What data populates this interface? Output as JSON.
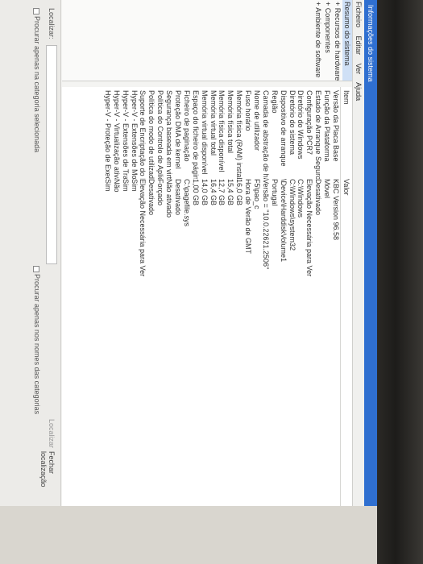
{
  "window": {
    "title": "Informações do sistema"
  },
  "menu": [
    "Ficheiro",
    "Editar",
    "Ver",
    "Ajuda"
  ],
  "tree": [
    {
      "label": "Resumo do sistema",
      "selected": true
    },
    {
      "label": "+ Recursos de hardware"
    },
    {
      "label": "+ Componentes"
    },
    {
      "label": "+ Ambiente de software"
    }
  ],
  "table": {
    "headers": {
      "item": "Item",
      "value": "Valor"
    },
    "rows": [
      {
        "item": "Versão da Placa Base",
        "value": "KBC Version 96.58"
      },
      {
        "item": "Função da Plataforma",
        "value": "Móvel"
      },
      {
        "item": "Estado de Arranque Seguro",
        "value": "Desativado"
      },
      {
        "item": "Configuração PCR7",
        "value": "Elevação Necessária para Ver"
      },
      {
        "item": "Diretório do Windows",
        "value": "C:\\Windows"
      },
      {
        "item": "Diretório do sistema",
        "value": "C:\\Windows\\system32"
      },
      {
        "item": "Dispositivo de arranque",
        "value": "\\Device\\HarddiskVolume1"
      },
      {
        "item": "Região",
        "value": "Portugal"
      },
      {
        "item": "Camada de abstração de hard...",
        "value": "Versão = \"10.0.22621.2506\""
      },
      {
        "item": "Nome de utilizador",
        "value": "F5\\pao_c"
      },
      {
        "item": "Fuso horário",
        "value": "Hora de Verão de GMT"
      },
      {
        "item": "Memória física (RAM) instalada",
        "value": "16,0 GB"
      },
      {
        "item": "Memória física total",
        "value": "15,4 GB"
      },
      {
        "item": "Memória física disponível",
        "value": "12,7 GB"
      },
      {
        "item": "Memória virtual total",
        "value": "16,4 GB"
      },
      {
        "item": "Memória virtual disponível",
        "value": "14,0 GB"
      },
      {
        "item": "Espaço do ficheiro de página",
        "value": "1,00 GB"
      },
      {
        "item": "Ficheiro de paginação",
        "value": "C:\\pagefile.sys"
      },
      {
        "item": "Proteção DMA de kernel",
        "value": "Desativado"
      },
      {
        "item": "Segurança baseada em virtuali...",
        "value": "Não ativado"
      },
      {
        "item": "Política do Controlo de Aplicaç...",
        "value": "Forçado"
      },
      {
        "item": "Política do modo de utilizador ...",
        "value": "Desativado"
      },
      {
        "item": "Suporte de Encriptação do Disp...",
        "value": "Elevação Necessária para Ver"
      },
      {
        "item": "Hyper-V - Extensões de Modo ...",
        "value": "Sim"
      },
      {
        "item": "Hyper-V - Extensões de Tradução...",
        "value": "Sim"
      },
      {
        "item": "Hyper-V - Virtualização ativada ...",
        "value": "Não"
      },
      {
        "item": "Hyper-V - Proteção de Execuçã...",
        "value": "Sim"
      }
    ]
  },
  "find": {
    "label": "Localizar:",
    "find_button": "Localizar",
    "close_button": "Fechar localização",
    "check_selected": "Procurar apenas na categoria selecionada",
    "check_names": "Procurar apenas nos nomes das categorias"
  },
  "colors": {
    "titlebar": "#2f6fd0",
    "selection": "#cfe0f6"
  }
}
